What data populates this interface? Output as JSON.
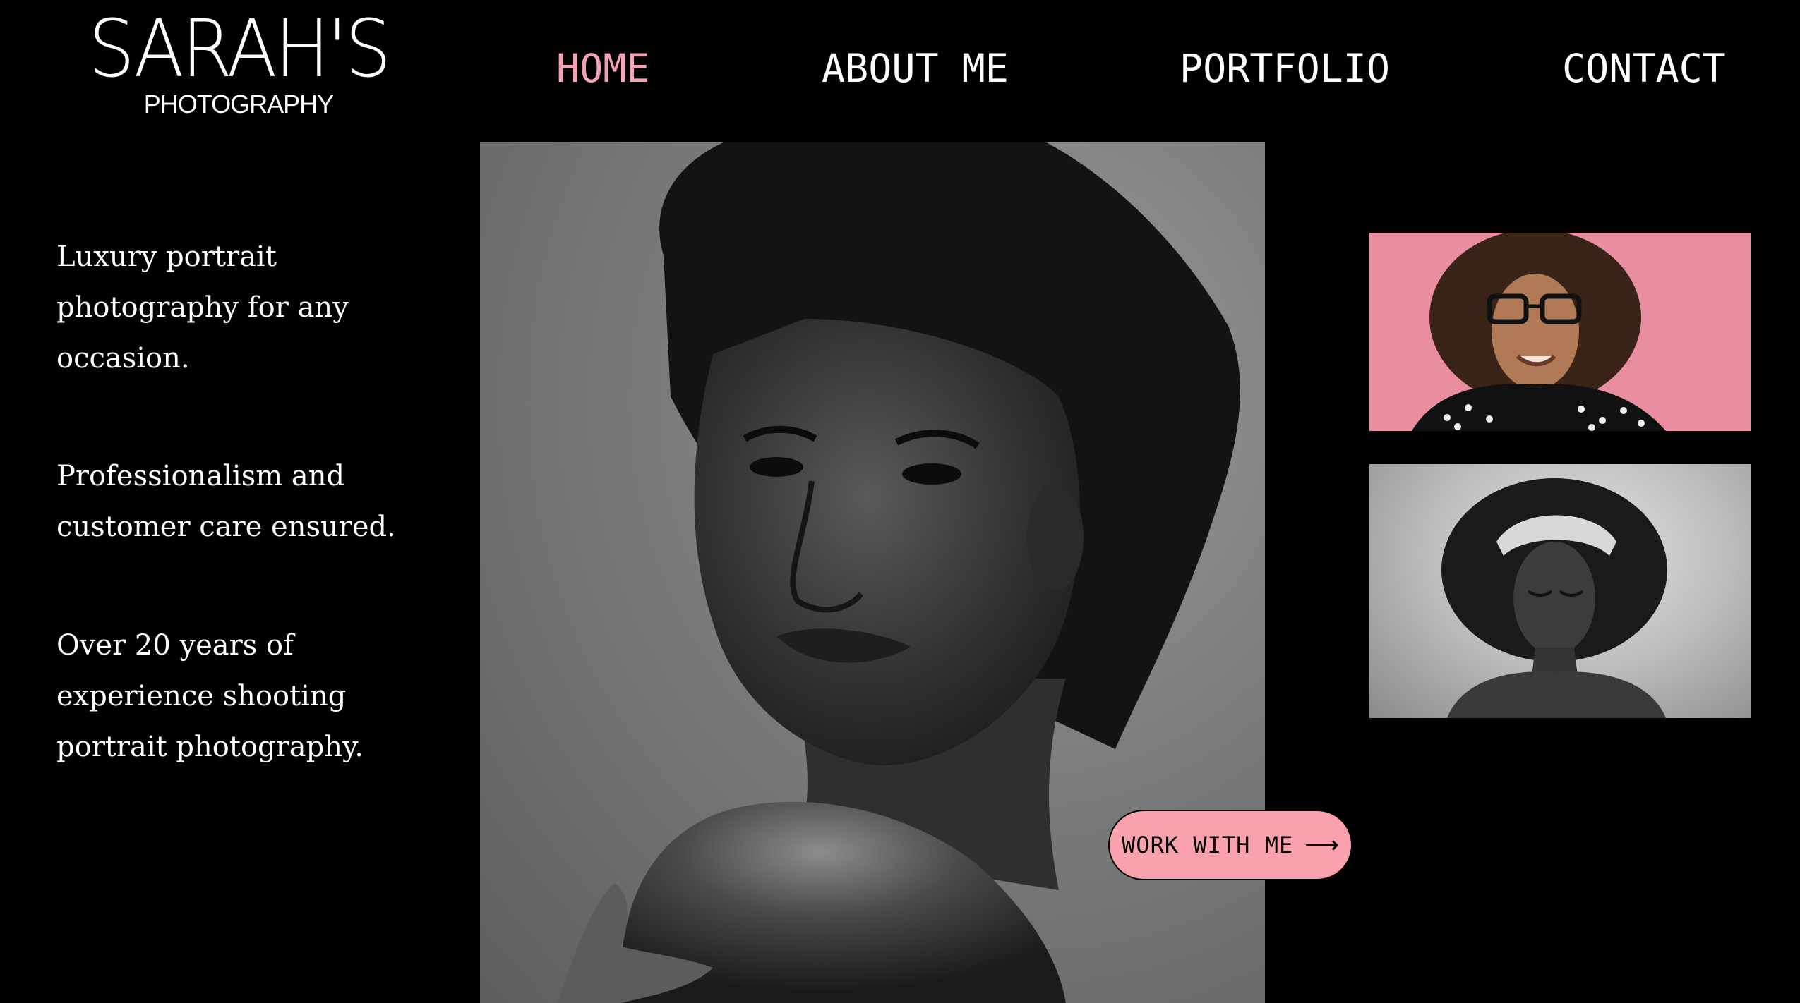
{
  "brand": {
    "name": "SARAH'S",
    "tagline": "PHOTOGRAPHY"
  },
  "nav": {
    "items": [
      {
        "label": "HOME",
        "active": true
      },
      {
        "label": "ABOUT ME",
        "active": false
      },
      {
        "label": "PORTFOLIO",
        "active": false
      },
      {
        "label": "CONTACT",
        "active": false
      }
    ]
  },
  "intro": {
    "paragraphs": [
      "Luxury portrait photography for any occasion.",
      "Professionalism and customer care ensured.",
      "Over 20 years of experience shooting portrait photography."
    ]
  },
  "cta": {
    "label": "WORK WITH ME",
    "icon": "arrow-right-icon"
  },
  "colors": {
    "background": "#000000",
    "accent_pink": "#f4a3b4",
    "button_pink": "#f9a2ae",
    "side_photo_pink": "#e88ea0"
  }
}
